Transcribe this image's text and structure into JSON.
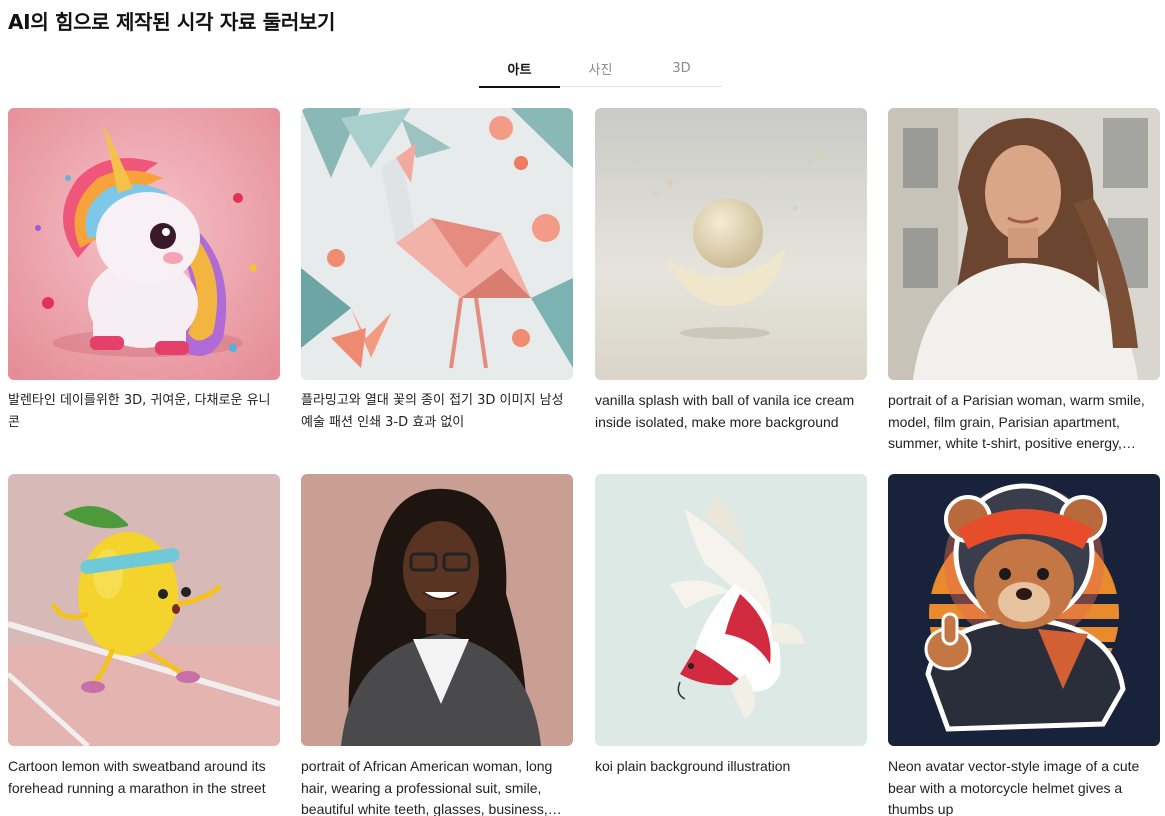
{
  "page": {
    "title": "AI의 힘으로 제작된 시각 자료 둘러보기"
  },
  "tabs": [
    {
      "label": "아트",
      "active": true
    },
    {
      "label": "사진",
      "active": false
    },
    {
      "label": "3D",
      "active": false
    }
  ],
  "gallery": [
    {
      "caption": "발렌타인 데이를위한 3D, 귀여운, 다채로운 유니콘",
      "icon": "unicorn-image"
    },
    {
      "caption": "플라밍고와 열대 꽃의 종이 접기 3D 이미지 남성 예술 패션 인쇄 3-D 효과 없이",
      "icon": "origami-flamingo-image"
    },
    {
      "caption": "vanilla splash with ball of vanila ice cream inside isolated, make more background",
      "icon": "ice-cream-image"
    },
    {
      "caption": "portrait of a Parisian woman, warm smile, model, film grain, Parisian apartment, summer, white t-shirt, positive energy,…",
      "icon": "parisian-woman-image"
    },
    {
      "caption": "Cartoon lemon with sweatband around its forehead running a marathon in the street",
      "icon": "lemon-runner-image"
    },
    {
      "caption": "portrait of African American woman, long hair, wearing a professional suit, smile, beautiful white teeth, glasses, business,…",
      "icon": "business-woman-image"
    },
    {
      "caption": "koi plain background illustration",
      "icon": "koi-fish-image"
    },
    {
      "caption": "Neon avatar vector-style image of a cute bear with a motorcycle helmet gives a thumbs up",
      "icon": "neon-bear-image"
    }
  ]
}
